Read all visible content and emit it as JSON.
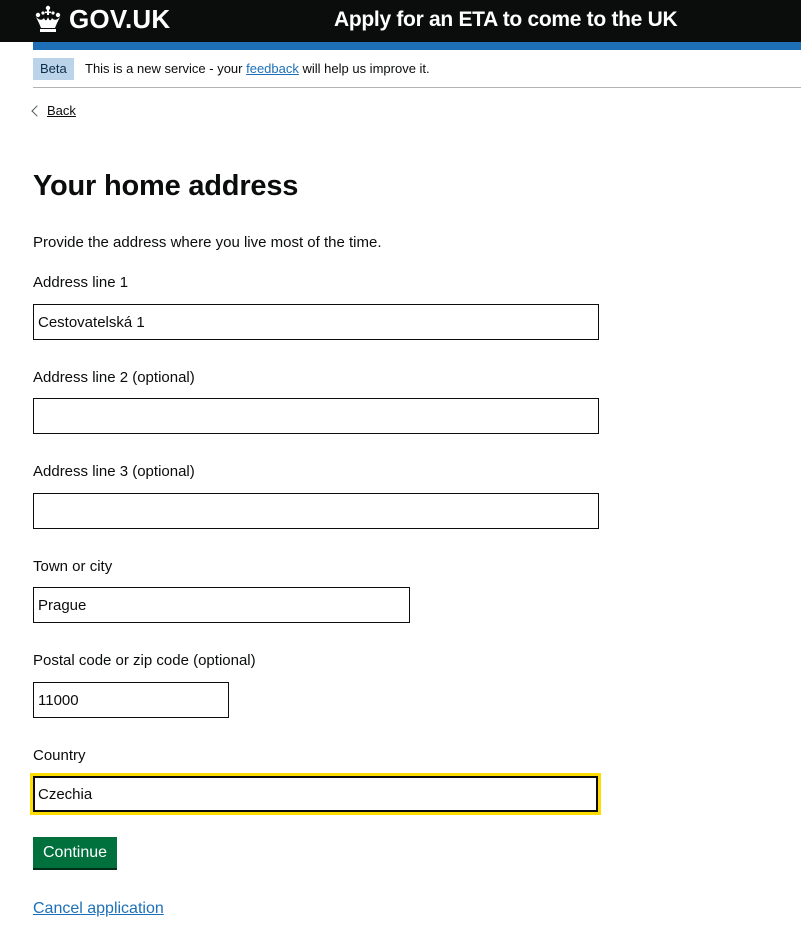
{
  "header": {
    "logo_text": "GOV.UK",
    "logo_icon": "crown-icon",
    "service_name": "Apply for an ETA to come to the UK"
  },
  "phase_banner": {
    "tag": "Beta",
    "text_before": "This is a new service - your ",
    "link_text": "feedback",
    "text_after": " will help us improve it."
  },
  "back_link": {
    "label": "Back",
    "icon": "chevron-left-icon"
  },
  "page": {
    "title": "Your home address",
    "hint": "Provide the address where you live most of the time."
  },
  "form": {
    "address_line_1": {
      "label": "Address line 1",
      "value": "Cestovatelská 1"
    },
    "address_line_2": {
      "label": "Address line 2 (optional)",
      "value": ""
    },
    "address_line_3": {
      "label": "Address line 3 (optional)",
      "value": ""
    },
    "town": {
      "label": "Town or city",
      "value": "Prague"
    },
    "postcode": {
      "label": "Postal code or zip code (optional)",
      "value": "11000"
    },
    "country": {
      "label": "Country",
      "value": "Czechia"
    }
  },
  "actions": {
    "continue_label": "Continue",
    "cancel_label": "Cancel application"
  },
  "colors": {
    "header_bg": "#0b0c0c",
    "brand_blue": "#1d70b8",
    "button_green": "#00703c",
    "focus_yellow": "#ffdd00",
    "beta_tag_bg": "#bbd4ea"
  }
}
